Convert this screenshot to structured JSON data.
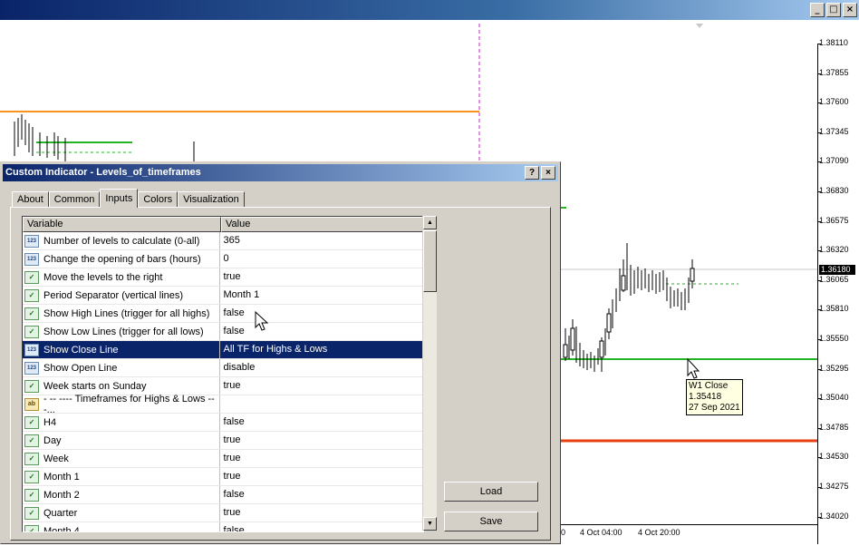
{
  "window": {
    "minimize_label": "_",
    "maximize_label": "□",
    "close_label": "×"
  },
  "chart": {
    "price_labels": [
      "1.38110",
      "1.37855",
      "1.37600",
      "1.37345",
      "1.37090",
      "1.36830",
      "1.36575",
      "1.36320",
      "1.36065",
      "1.35810",
      "1.35550",
      "1.35295",
      "1.35040",
      "1.34785",
      "1.34530",
      "1.34275",
      "1.34020"
    ],
    "current_price": "1.36180",
    "time_labels": [
      "0",
      "4 Oct 04:00",
      "4 Oct 20:00"
    ],
    "tooltip": {
      "line1": "W1 Close",
      "line2": "1.35418",
      "line3": "27 Sep 2021"
    },
    "colors": {
      "orange_level": "#f7941d",
      "green_level": "#22b422",
      "red_level": "#e84010"
    }
  },
  "dialog": {
    "title": "Custom Indicator - Levels_of_timeframes",
    "help_label": "?",
    "close_label": "×",
    "tabs": [
      "About",
      "Common",
      "Inputs",
      "Colors",
      "Visualization"
    ],
    "active_tab": "Inputs",
    "columns": {
      "variable": "Variable",
      "value": "Value"
    },
    "rows": [
      {
        "type": "int",
        "icon": "123",
        "variable": "Number of levels to calculate (0-all)",
        "value": "365"
      },
      {
        "type": "int",
        "icon": "123",
        "variable": "Change the opening of bars (hours)",
        "value": "0"
      },
      {
        "type": "bool",
        "icon": "✓",
        "variable": "Move the levels to the right",
        "value": "true"
      },
      {
        "type": "bool",
        "icon": "✓",
        "variable": "Period Separator (vertical lines)",
        "value": "Month 1"
      },
      {
        "type": "bool",
        "icon": "✓",
        "variable": "Show High Lines (trigger for all highs)",
        "value": "false"
      },
      {
        "type": "bool",
        "icon": "✓",
        "variable": "Show Low Lines (trigger for all lows)",
        "value": "false"
      },
      {
        "type": "int",
        "icon": "123",
        "variable": "Show Close Line",
        "value": "All TF for Highs & Lows",
        "selected": true
      },
      {
        "type": "int",
        "icon": "123",
        "variable": "Show Open Line",
        "value": "disable"
      },
      {
        "type": "bool",
        "icon": "✓",
        "variable": "Week starts on Sunday",
        "value": "true"
      },
      {
        "type": "str",
        "icon": "ab",
        "variable": "- -- ---- Timeframes for Highs & Lows ---...",
        "value": ""
      },
      {
        "type": "bool",
        "icon": "✓",
        "variable": "H4",
        "value": "false"
      },
      {
        "type": "bool",
        "icon": "✓",
        "variable": "Day",
        "value": "true"
      },
      {
        "type": "bool",
        "icon": "✓",
        "variable": "Week",
        "value": "true"
      },
      {
        "type": "bool",
        "icon": "✓",
        "variable": "Month 1",
        "value": "true"
      },
      {
        "type": "bool",
        "icon": "✓",
        "variable": "Month 2",
        "value": "false"
      },
      {
        "type": "bool",
        "icon": "✓",
        "variable": "Quarter",
        "value": "true"
      },
      {
        "type": "bool",
        "icon": "✓",
        "variable": "Month 4",
        "value": "false"
      }
    ],
    "load_label": "Load",
    "save_label": "Save"
  }
}
